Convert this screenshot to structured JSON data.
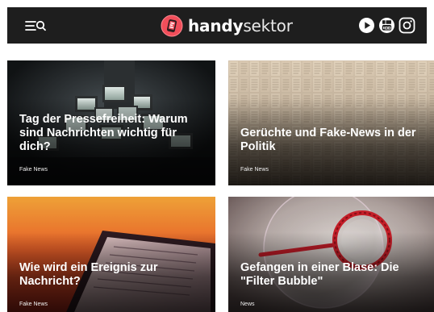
{
  "header": {
    "menu_icon": "hamburger-icon",
    "search_icon": "search-icon",
    "brand": {
      "name_bold": "handy",
      "name_light": "sektor",
      "logo_icon": "handysektor-logo-icon",
      "logo_color": "#f04e5a"
    },
    "social_icons": [
      "play-icon",
      "youtube-icon",
      "instagram-icon"
    ]
  },
  "articles": [
    {
      "title": "Tag der Pressefreiheit: Warum sind Nachrichten wichtig für dich?",
      "category": "Fake News",
      "image": "tv-screens-photo"
    },
    {
      "title": "Gerüchte und Fake-News in der Politik",
      "category": "Fake News",
      "image": "newspaper-pages-photo"
    },
    {
      "title": "Wie wird ein Ereignis zur Nachricht?",
      "category": "Fake News",
      "image": "smartphone-news-photo"
    },
    {
      "title": "Gefangen in einer Blase: Die \"Filter Bubble\"",
      "category": "News",
      "image": "soap-bubble-photo"
    }
  ],
  "colors": {
    "header_bg": "#1e1e1e",
    "text_on_image": "#ffffff"
  }
}
